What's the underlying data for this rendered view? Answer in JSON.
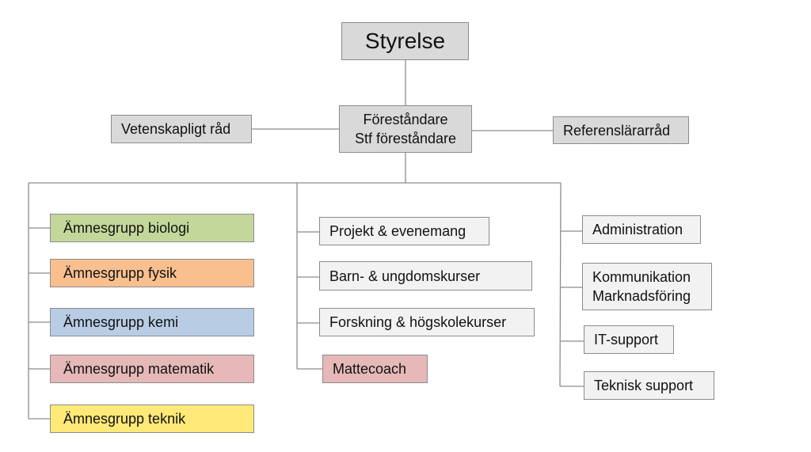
{
  "top": {
    "label": "Styrelse"
  },
  "management": {
    "line1": "Föreståndare",
    "line2": "Stf föreståndare"
  },
  "side_left": {
    "label": "Vetenskapligt råd"
  },
  "side_right": {
    "label": "Referenslärarråd"
  },
  "subject_groups": [
    {
      "label": "Ämnesgrupp biologi",
      "color": "#c4d79b"
    },
    {
      "label": "Ämnesgrupp fysik",
      "color": "#f9bf8f"
    },
    {
      "label": "Ämnesgrupp kemi",
      "color": "#b8cce4"
    },
    {
      "label": "Ämnesgrupp matematik",
      "color": "#e6b8b8"
    },
    {
      "label": "Ämnesgrupp teknik",
      "color": "#ffe978"
    }
  ],
  "activities": [
    {
      "label": "Projekt & evenemang"
    },
    {
      "label": "Barn- & ungdomskurser"
    },
    {
      "label": "Forskning & högskolekurser"
    },
    {
      "label": "Mattecoach",
      "color": "#e6b8b8"
    }
  ],
  "support": {
    "administration": "Administration",
    "communication_line1": "Kommunikation",
    "communication_line2": "Marknadsföring",
    "it": "IT-support",
    "technical": "Teknisk support"
  }
}
